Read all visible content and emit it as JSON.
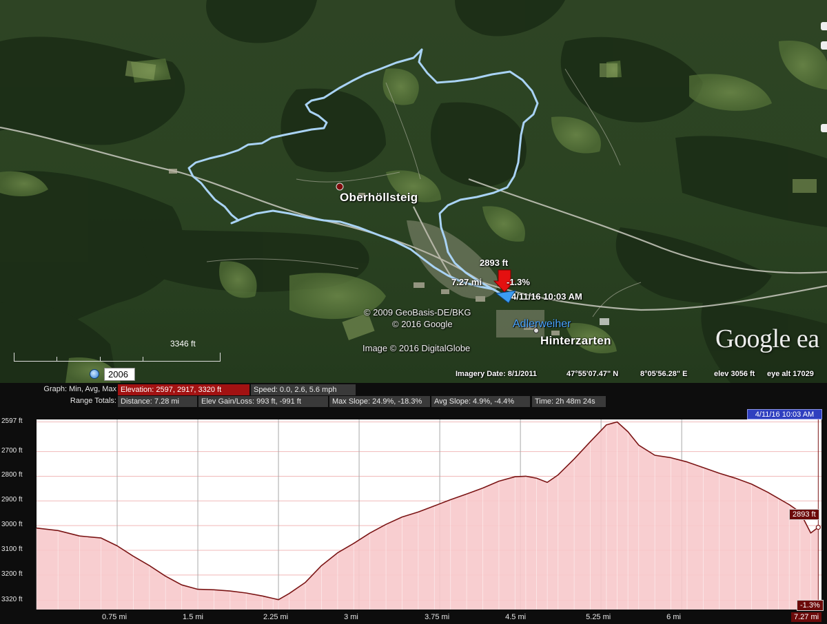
{
  "map": {
    "places": {
      "oberhollsteig": "Oberhöllsteig",
      "hinterzarten": "Hinterzarten",
      "adlerweiher": "Adlerweiher"
    },
    "cursor": {
      "elevation": "2893 ft",
      "distance": "7.27 mi",
      "slope": "-1.3%",
      "time": "4/11/16 10:03 AM"
    },
    "copyright": {
      "geobasis": "© 2009 GeoBasis-DE/BKG",
      "google": "© 2016 Google",
      "image": "Image © 2016 DigitalGlobe"
    },
    "logo": "Google ea",
    "scale_label": "3346 ft",
    "historical_year": "2006",
    "status": {
      "imagery_date": "Imagery Date: 8/1/2011",
      "lat": "47°55'07.47\" N",
      "lon": "8°05'56.28\" E",
      "elev": "elev  3056 ft",
      "eye_alt": "eye alt  17029"
    },
    "colors": {
      "track": "#a9d3f5",
      "marker_red": "#e41010",
      "marker_blue": "#3b9cf2"
    }
  },
  "stats": {
    "graph_label": "Graph: Min, Avg, Max",
    "elevation": "Elevation: 2597, 2917, 3320 ft",
    "speed": "Speed: 0.0, 2.6, 5.6 mph",
    "range_label": "Range Totals:",
    "distance": "Distance: 7.28 mi",
    "elev_gain_loss": "Elev Gain/Loss: 993 ft, -991 ft",
    "max_slope": "Max Slope: 24.9%, -18.3%",
    "avg_slope": "Avg Slope: 4.9%, -4.4%",
    "time": "Time: 2h 48m 24s"
  },
  "graph": {
    "time_badge": "4/11/16 10:03 AM",
    "current_elev": "2893 ft",
    "current_slope": "-1.3%",
    "current_dist": "7.27 mi",
    "y_tick_labels": [
      "3320 ft",
      "3200 ft",
      "3100 ft",
      "3000 ft",
      "2900 ft",
      "2800 ft",
      "2700 ft",
      "2597 ft"
    ],
    "x_tick_labels": [
      "0.75 mi",
      "1.5 mi",
      "2.25 mi",
      "3 mi",
      "3.75 mi",
      "4.5 mi",
      "5.25 mi",
      "6 mi"
    ],
    "colors": {
      "fill": "#f7c9cb",
      "line": "#7a1414",
      "grid": "#f0b8b8"
    }
  },
  "chart_data": {
    "type": "area",
    "title": "",
    "xlabel": "",
    "ylabel": "",
    "x_unit": "mi",
    "y_unit": "ft",
    "xlim": [
      0,
      7.3
    ],
    "ylim": [
      2560,
      3330
    ],
    "y_ticks": [
      2597,
      2700,
      2800,
      2900,
      3000,
      3100,
      3200,
      3320
    ],
    "x_ticks": [
      0.75,
      1.5,
      2.25,
      3,
      3.75,
      4.5,
      5.25,
      6
    ],
    "grid": true,
    "series": [
      {
        "x": [
          0,
          0.2,
          0.4,
          0.6,
          0.75,
          0.9,
          1.05,
          1.2,
          1.35,
          1.5,
          1.65,
          1.8,
          1.95,
          2.1,
          2.2,
          2.25,
          2.35,
          2.5,
          2.65,
          2.8,
          2.95,
          3.1,
          3.25,
          3.4,
          3.55,
          3.7,
          3.85,
          4.0,
          4.15,
          4.3,
          4.45,
          4.55,
          4.65,
          4.75,
          4.85,
          5.0,
          5.15,
          5.3,
          5.4,
          5.5,
          5.6,
          5.75,
          5.9,
          6.05,
          6.2,
          6.35,
          6.5,
          6.65,
          6.8,
          6.9,
          7.0,
          7.1,
          7.2,
          7.27
        ],
        "y": [
          2890,
          2880,
          2858,
          2850,
          2818,
          2776,
          2738,
          2695,
          2660,
          2642,
          2640,
          2635,
          2627,
          2615,
          2605,
          2600,
          2625,
          2670,
          2738,
          2790,
          2828,
          2870,
          2905,
          2935,
          2955,
          2980,
          3005,
          3028,
          3052,
          3080,
          3098,
          3100,
          3092,
          3075,
          3105,
          3170,
          3240,
          3308,
          3320,
          3280,
          3226,
          3185,
          3175,
          3158,
          3135,
          3112,
          3092,
          3068,
          3035,
          3010,
          2985,
          2955,
          2870,
          2893
        ]
      }
    ]
  }
}
